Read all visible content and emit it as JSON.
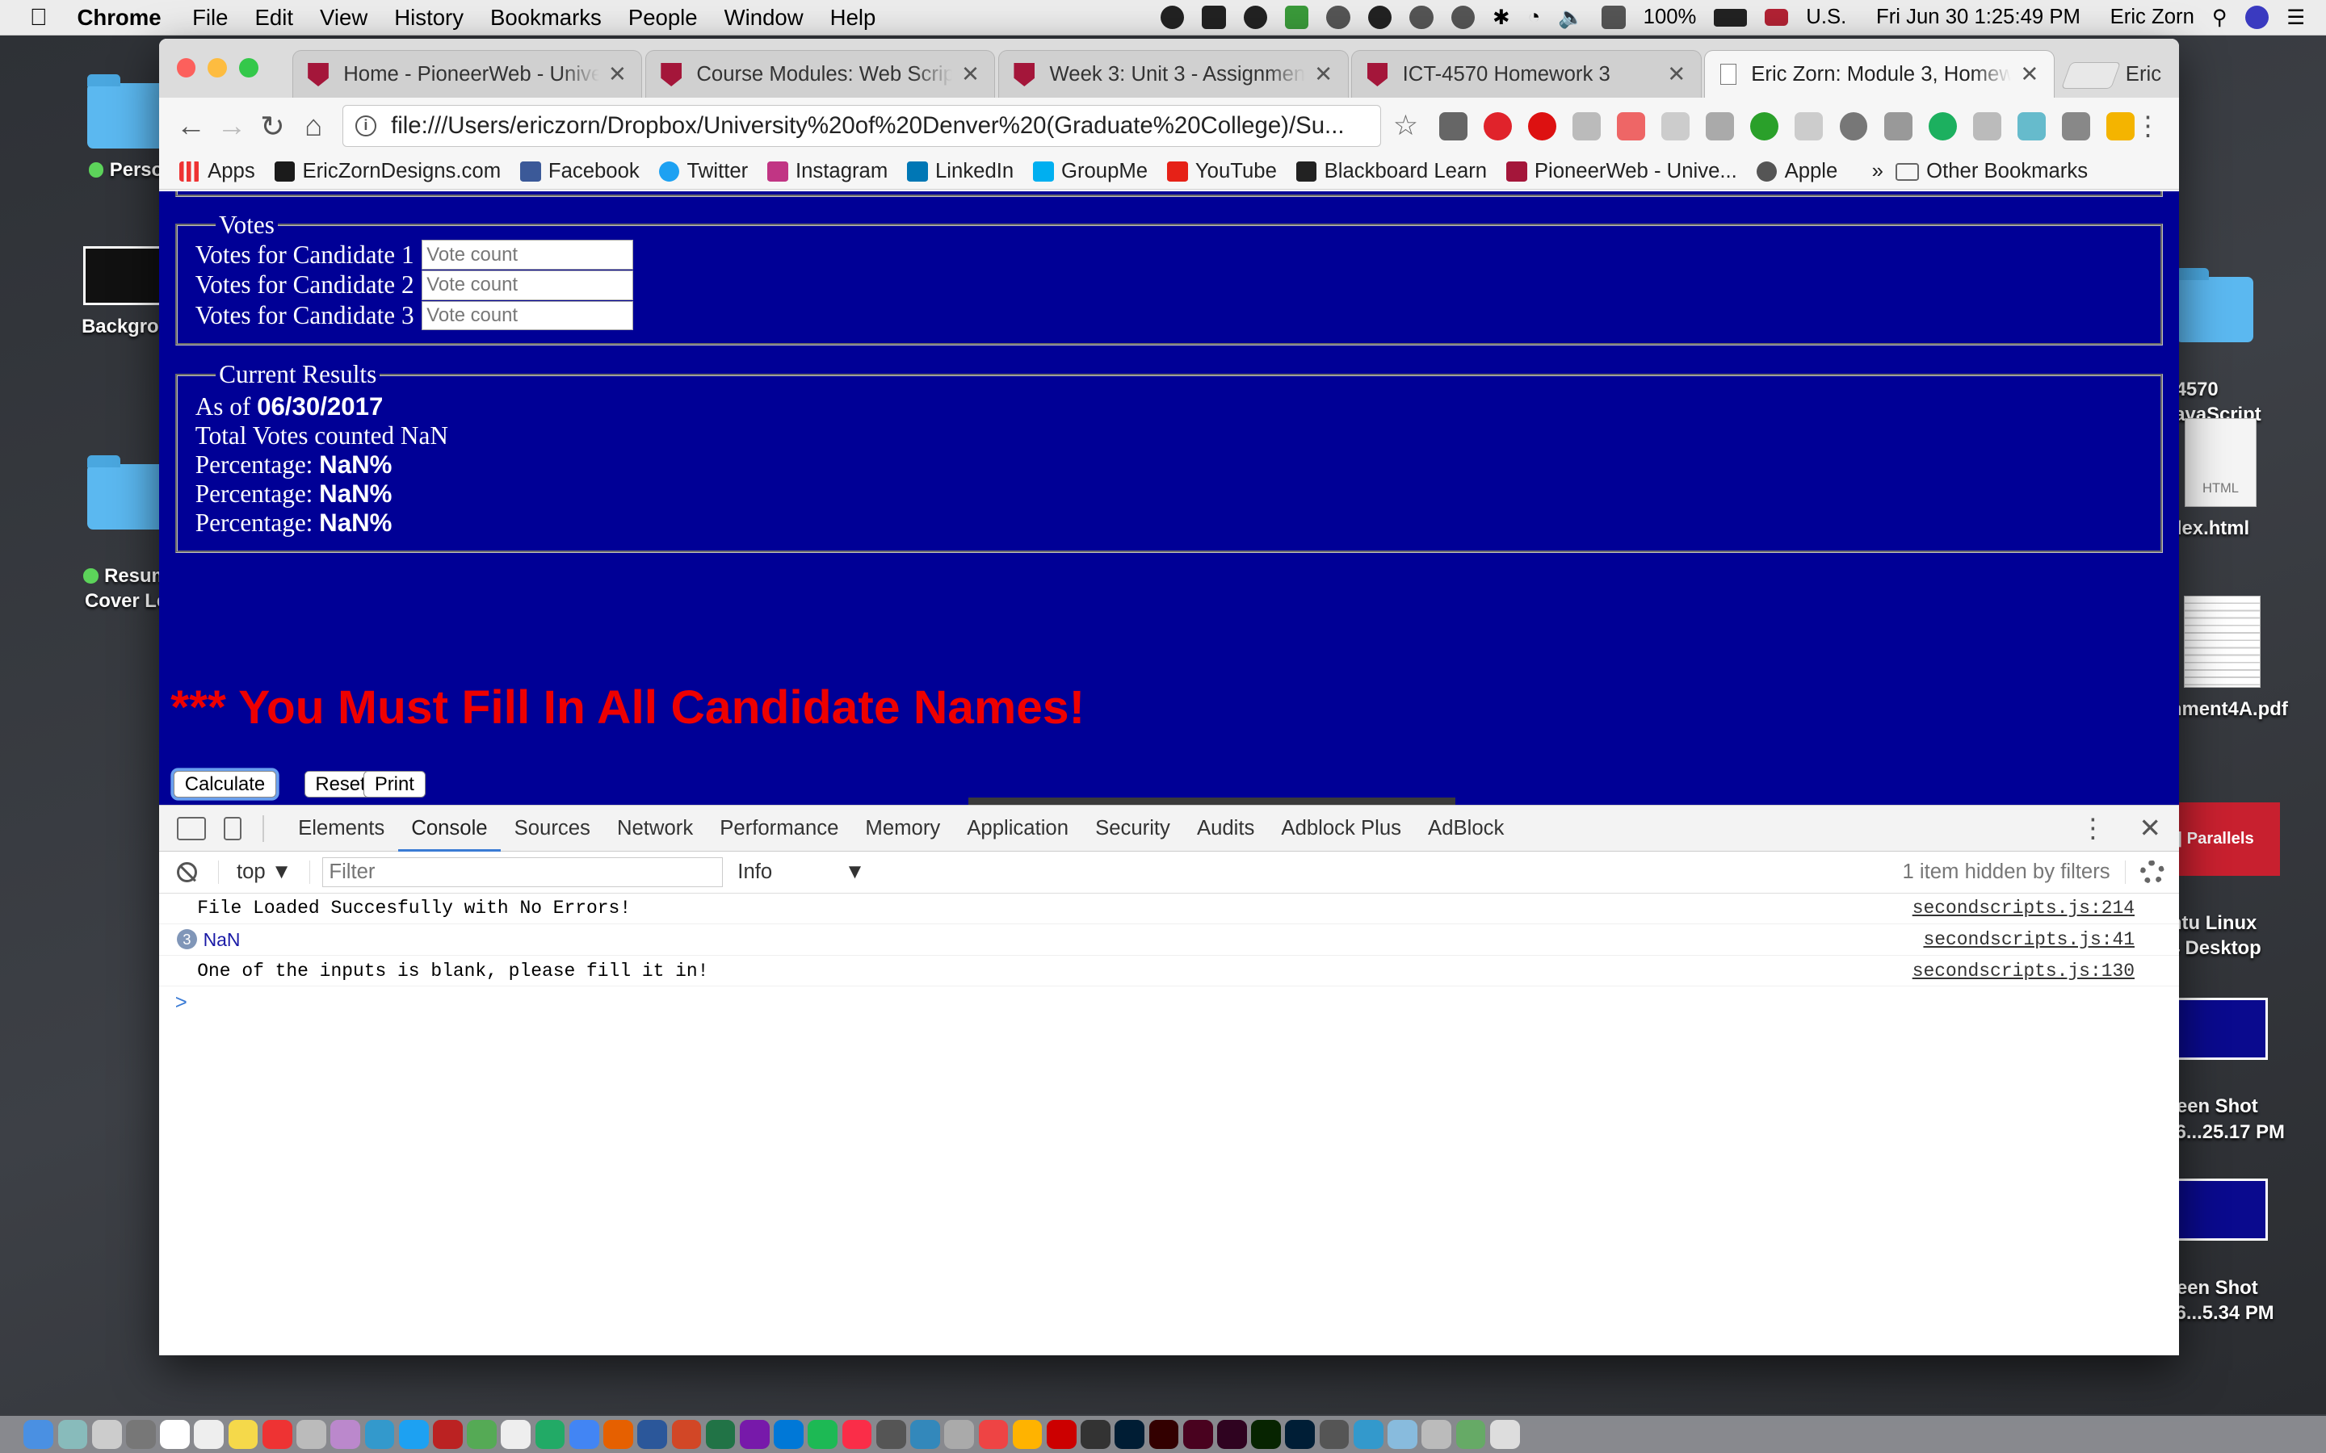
{
  "menubar": {
    "app": "Chrome",
    "menus": [
      "File",
      "Edit",
      "View",
      "History",
      "Bookmarks",
      "People",
      "Window",
      "Help"
    ],
    "battery": "100%",
    "input_source": "U.S.",
    "clock": "Fri Jun 30  1:25:49 PM",
    "user": "Eric Zorn"
  },
  "desktop": {
    "left_items": [
      {
        "label": "Perso",
        "icon": "folder-icon",
        "status": "green"
      },
      {
        "label": "Backgrou",
        "icon": "image-thumb-icon"
      },
      {
        "label": "Resum\nCover Le",
        "icon": "folder-icon",
        "status": "green"
      }
    ],
    "right_items": [
      {
        "label": "T 4570\n...avaScript",
        "icon": "folder-icon"
      },
      {
        "label": "ndex.html",
        "icon": "html-file-icon",
        "badge": "HTML"
      },
      {
        "label": "gnment4A.pdf",
        "icon": "pdf-file-icon"
      },
      {
        "label": "untu Linux\n04 Desktop",
        "icon": "parallels-icon",
        "badge": "|| Parallels"
      },
      {
        "label": "creen Shot\n-06...25.17 PM",
        "icon": "screenshot-icon"
      },
      {
        "label": "creen Shot\n-06...5.34 PM",
        "icon": "screenshot-icon"
      }
    ]
  },
  "tabs": [
    {
      "title": "Home - PioneerWeb - University",
      "active": false
    },
    {
      "title": "Course Modules: Web Scripting",
      "active": false
    },
    {
      "title": "Week 3: Unit 3 - Assignment",
      "active": false
    },
    {
      "title": "ICT-4570 Homework 3",
      "active": false
    },
    {
      "title": "Eric Zorn: Module 3, Homework",
      "active": true
    }
  ],
  "profile_name": "Eric",
  "address": "file:///Users/ericzorn/Dropbox/University%20of%20Denver%20(Graduate%20College)/Su...",
  "bookmarks": [
    {
      "label": "Apps",
      "color": "#e33"
    },
    {
      "label": "EricZornDesigns.com",
      "color": "#1b1b1b"
    },
    {
      "label": "Facebook",
      "color": "#3b5998"
    },
    {
      "label": "Twitter",
      "color": "#1da1f2"
    },
    {
      "label": "Instagram",
      "color": "#c13584"
    },
    {
      "label": "LinkedIn",
      "color": "#0077b5"
    },
    {
      "label": "GroupMe",
      "color": "#00aff0"
    },
    {
      "label": "YouTube",
      "color": "#e62117"
    },
    {
      "label": "Blackboard Learn",
      "color": "#222"
    },
    {
      "label": "PioneerWeb - Unive...",
      "color": "#a4163a"
    },
    {
      "label": "Apple",
      "color": "#555"
    }
  ],
  "other_bookmarks": "Other Bookmarks",
  "page": {
    "votes_legend": "Votes",
    "vote_rows": [
      {
        "label": "Votes for Candidate 1",
        "placeholder": "Vote count"
      },
      {
        "label": "Votes for Candidate 2",
        "placeholder": "Vote count"
      },
      {
        "label": "Votes for Candidate 3",
        "placeholder": "Vote count"
      }
    ],
    "results_legend": "Current Results",
    "as_of_label": "As of",
    "as_of_date": "06/30/2017",
    "total_label": "Total Votes counted NaN",
    "percent_label": "Percentage:",
    "percent_value": "NaN%",
    "warning": "*** You Must Fill In All Candidate Names!",
    "buttons": {
      "calculate": "Calculate",
      "reset": "Reset",
      "print": "Print"
    },
    "background": "#000096",
    "warning_color": "#e00000"
  },
  "devtools": {
    "tabs": [
      "Elements",
      "Console",
      "Sources",
      "Network",
      "Performance",
      "Memory",
      "Application",
      "Security",
      "Audits",
      "Adblock Plus",
      "AdBlock"
    ],
    "active_tab": "Console",
    "context": "top",
    "filter_placeholder": "Filter",
    "level": "Info",
    "hidden_note": "1 item hidden by filters",
    "messages": [
      {
        "text": "File Loaded Succesfully with No Errors!",
        "source": "secondscripts.js:214"
      },
      {
        "text": "NaN",
        "source": "secondscripts.js:41",
        "count": "3"
      },
      {
        "text": "One of the inputs is blank, please fill it in!",
        "source": "secondscripts.js:130"
      }
    ],
    "prompt": ">"
  }
}
